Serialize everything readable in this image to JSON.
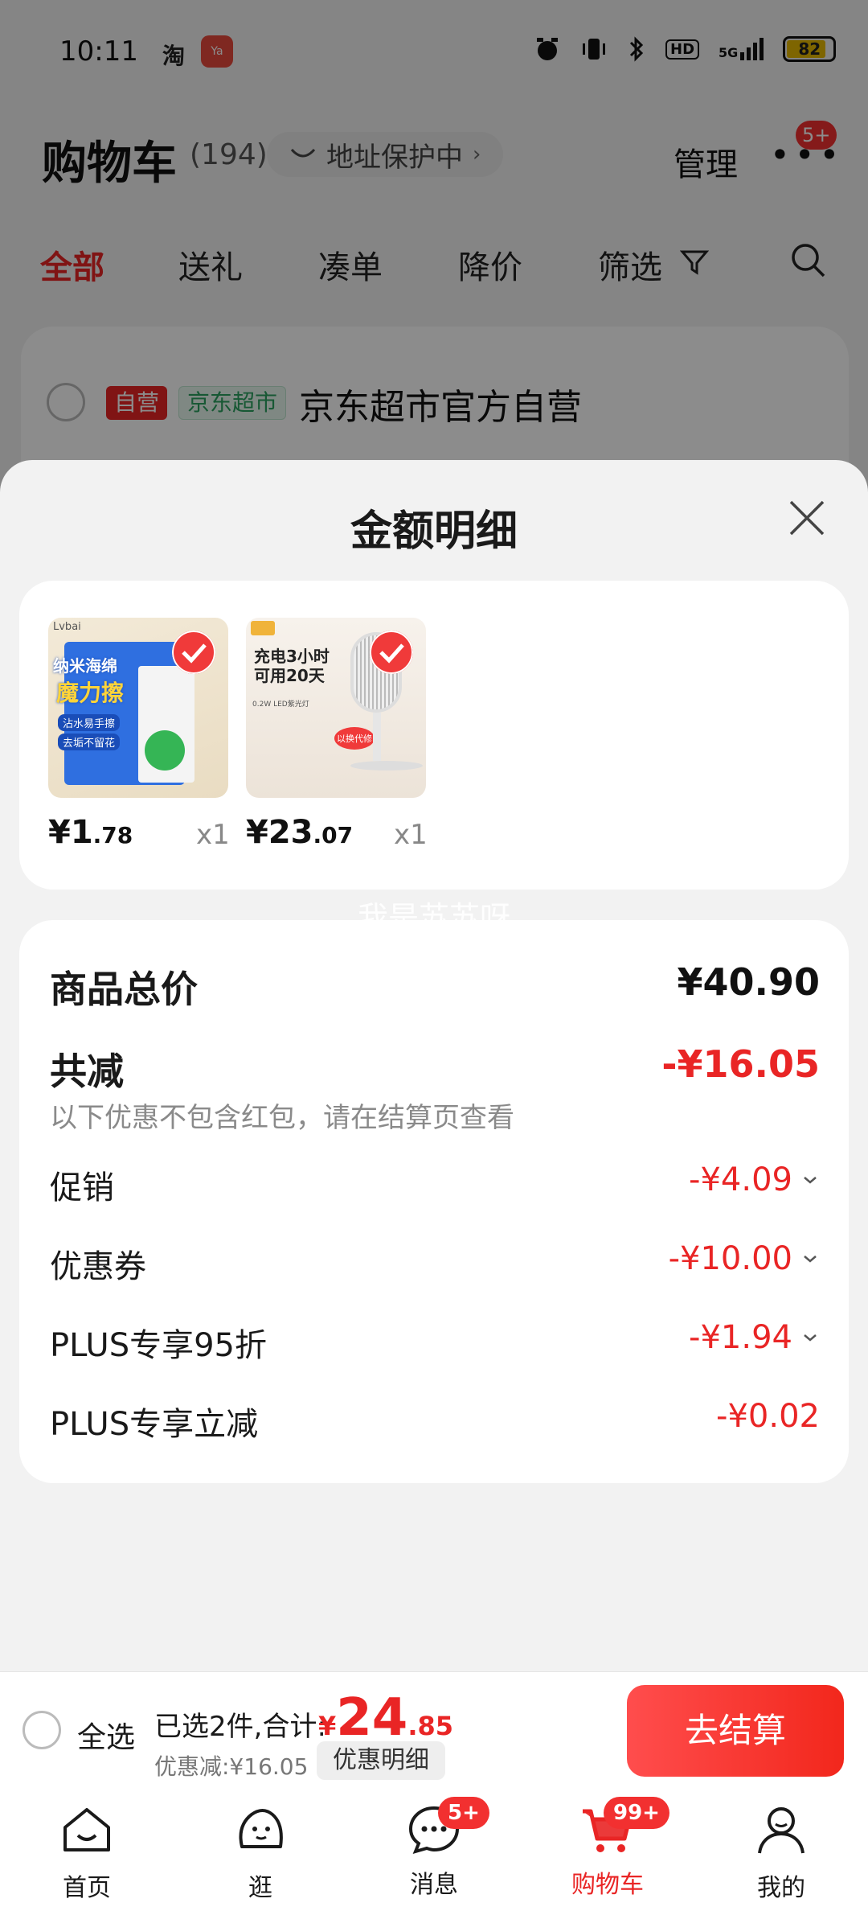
{
  "status_bar": {
    "time": "10:11",
    "app1": "淘",
    "app2": "Ya",
    "network": "HD",
    "signal": "5G",
    "battery": "82"
  },
  "cart_header": {
    "title": "购物车",
    "count": "(194)",
    "address": "地址保护中",
    "manage": "管理",
    "more_badge": "5+"
  },
  "filter_tabs": [
    "全部",
    "送礼",
    "凑单",
    "降价",
    "筛选"
  ],
  "store": {
    "tag_self": "自营",
    "tag_super": "京东超市",
    "name": "京东超市官方自营"
  },
  "sheet": {
    "title": "金额明细",
    "watermark": "我是苏苏呀"
  },
  "products": [
    {
      "price_int": "¥1",
      "price_dec": ".78",
      "qty": "x1",
      "img_lines": [
        "Lvbai",
        "纳米海绵",
        "魔力擦",
        "沾水易手擦",
        "去垢不留花"
      ]
    },
    {
      "price_int": "¥23",
      "price_dec": ".07",
      "qty": "x1",
      "img_lines": [
        "充电3小时",
        "可用20天",
        "0.2W LED紫光灯",
        "以换代修"
      ]
    }
  ],
  "summary": {
    "total_label": "商品总价",
    "total_value": "¥40.90",
    "reduce_label": "共减",
    "reduce_value": "-¥16.05",
    "note": "以下优惠不包含红包，请在结算页查看",
    "rows": [
      {
        "label": "促销",
        "value": "-¥4.09"
      },
      {
        "label": "优惠券",
        "value": "-¥10.00"
      },
      {
        "label": "PLUS专享95折",
        "value": "-¥1.94"
      },
      {
        "label": "PLUS专享立减",
        "value": "-¥0.02"
      }
    ]
  },
  "action_bar": {
    "select_all": "全选",
    "selected": "已选2件,合计:",
    "total_cur": "¥",
    "total_int": "24",
    "total_dec": ".85",
    "discount": "优惠减:¥16.05",
    "detail_chip": "优惠明细",
    "checkout": "去结算"
  },
  "bottom_nav": [
    {
      "label": "首页",
      "icon": "home-icon"
    },
    {
      "label": "逛",
      "icon": "browse-icon"
    },
    {
      "label": "消息",
      "icon": "message-icon",
      "badge": "5+"
    },
    {
      "label": "购物车",
      "icon": "cart-icon",
      "badge": "99+"
    },
    {
      "label": "我的",
      "icon": "profile-icon"
    }
  ],
  "colors": {
    "accent": "#e92525",
    "sheet_bg": "#f2f2f2",
    "card_bg": "#ffffff"
  }
}
